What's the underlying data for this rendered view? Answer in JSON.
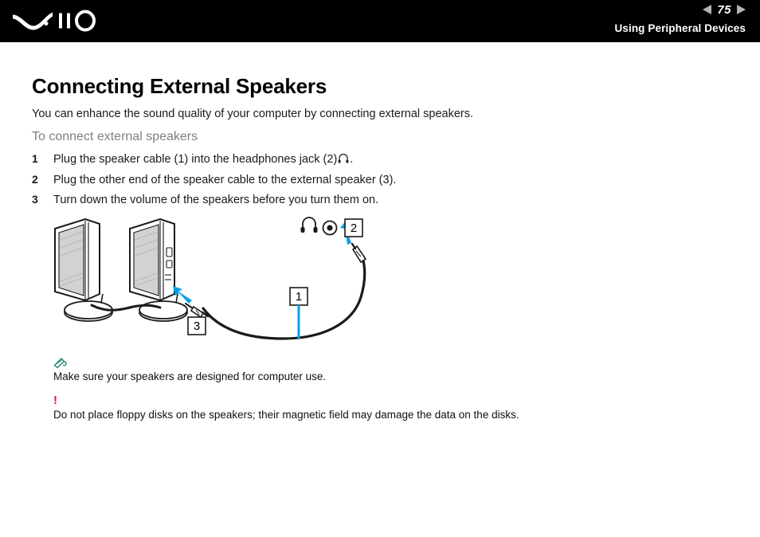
{
  "header": {
    "logo_name": "vaio-logo",
    "page_number": "75",
    "prev_arrow": "◀",
    "next_arrow": "▶",
    "section_title": "Using Peripheral Devices",
    "background_color": "#000000",
    "arrow_color": "#b4b4b4"
  },
  "document": {
    "title": "Connecting External Speakers",
    "intro": "You can enhance the sound quality of your computer by connecting external speakers.",
    "sub_heading": "To connect external speakers",
    "sub_heading_color": "#808080",
    "steps": [
      {
        "number": "1",
        "text_before": "Plug the speaker cable (1) into the headphones jack (2)",
        "icon": "headphones-jack-icon",
        "text_after": "."
      },
      {
        "number": "2",
        "text_before": "Plug the other end of the speaker cable to the external speaker (3).",
        "icon": "",
        "text_after": ""
      },
      {
        "number": "3",
        "text_before": "Turn down the volume of the speakers before you turn them on.",
        "icon": "",
        "text_after": ""
      }
    ]
  },
  "figure": {
    "name": "external-speakers-connection-diagram",
    "callouts": [
      {
        "label": "1",
        "target": "speaker-cable"
      },
      {
        "label": "2",
        "target": "headphones-jack-port"
      },
      {
        "label": "3",
        "target": "external-speaker-input"
      }
    ],
    "port_icons": [
      {
        "name": "headphones-icon",
        "glyph": "headphones"
      },
      {
        "name": "jack-port-icon",
        "glyph": "circle-in-circle"
      }
    ],
    "accent_color": "#00a0e9",
    "line_color": "#1a1a1a",
    "speaker_fill": "#ffffff",
    "speaker_panel_fill": "#d2d2d2"
  },
  "notes": [
    {
      "icon": "note-pencil-icon",
      "icon_color": "#1f8a70",
      "text": "Make sure your speakers are designed for computer use."
    },
    {
      "icon": "caution-exclamation-icon",
      "icon_color": "#e8112d",
      "mark": "!",
      "text": "Do not place floppy disks on the speakers; their magnetic field may damage the data on the disks."
    }
  ]
}
